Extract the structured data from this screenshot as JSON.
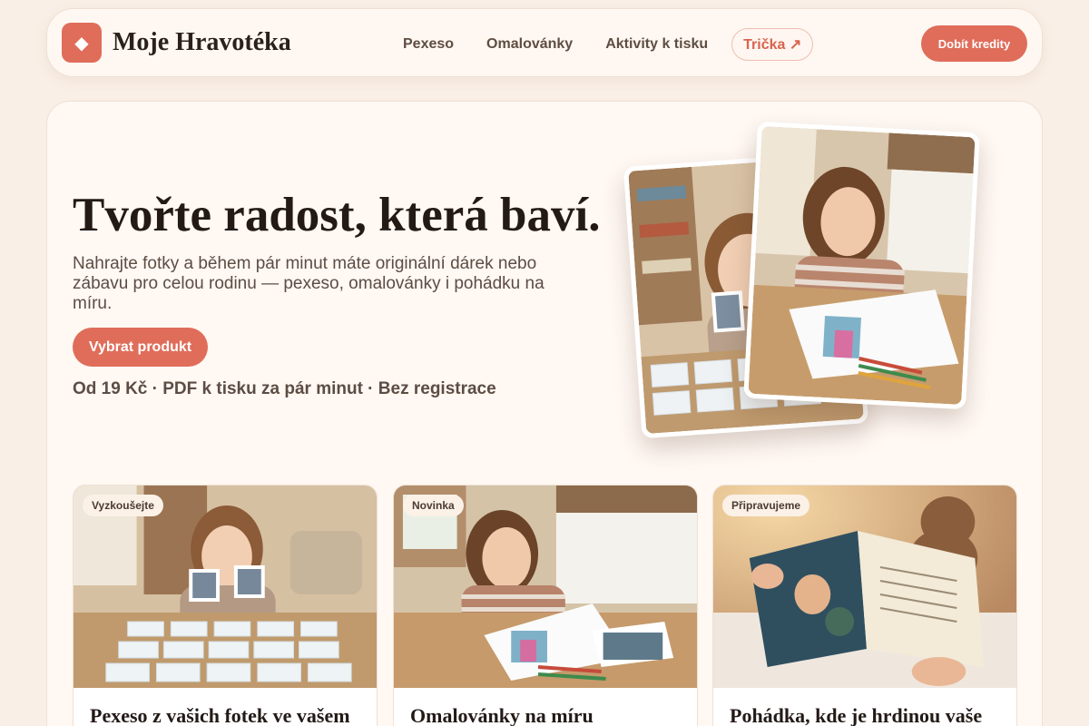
{
  "nav": {
    "logo_glyph": "◆",
    "brand": "Moje Hravotéka",
    "links": [
      "Pexeso",
      "Omalovánky",
      "Aktivity k tisku"
    ],
    "pill": "Trička ↗",
    "credits_button": "Dobít kredity"
  },
  "hero": {
    "title": "Tvořte radost, která baví.",
    "subtitle": "Nahrajte fotky a během pár minut máte originální dárek nebo zábavu pro celou rodinu — pexeso, omalovánky i pohádku na míru.",
    "cta": "Vybrat produkt",
    "meta": "Od 19 Kč · PDF k tisku za pár minut · Bez registrace"
  },
  "cards": [
    {
      "badge": " Vyzkoušejte",
      "title": "Pexeso z vašich fotek ve vašem"
    },
    {
      "badge": " Novinka",
      "title": "Omalovánky na míru"
    },
    {
      "badge": "Připravujeme",
      "title": "Pohádka, kde je hrdinou vaše"
    }
  ],
  "colors": {
    "accent": "#df6d5a",
    "background": "#f9efe6",
    "surface": "#fff8f3"
  }
}
